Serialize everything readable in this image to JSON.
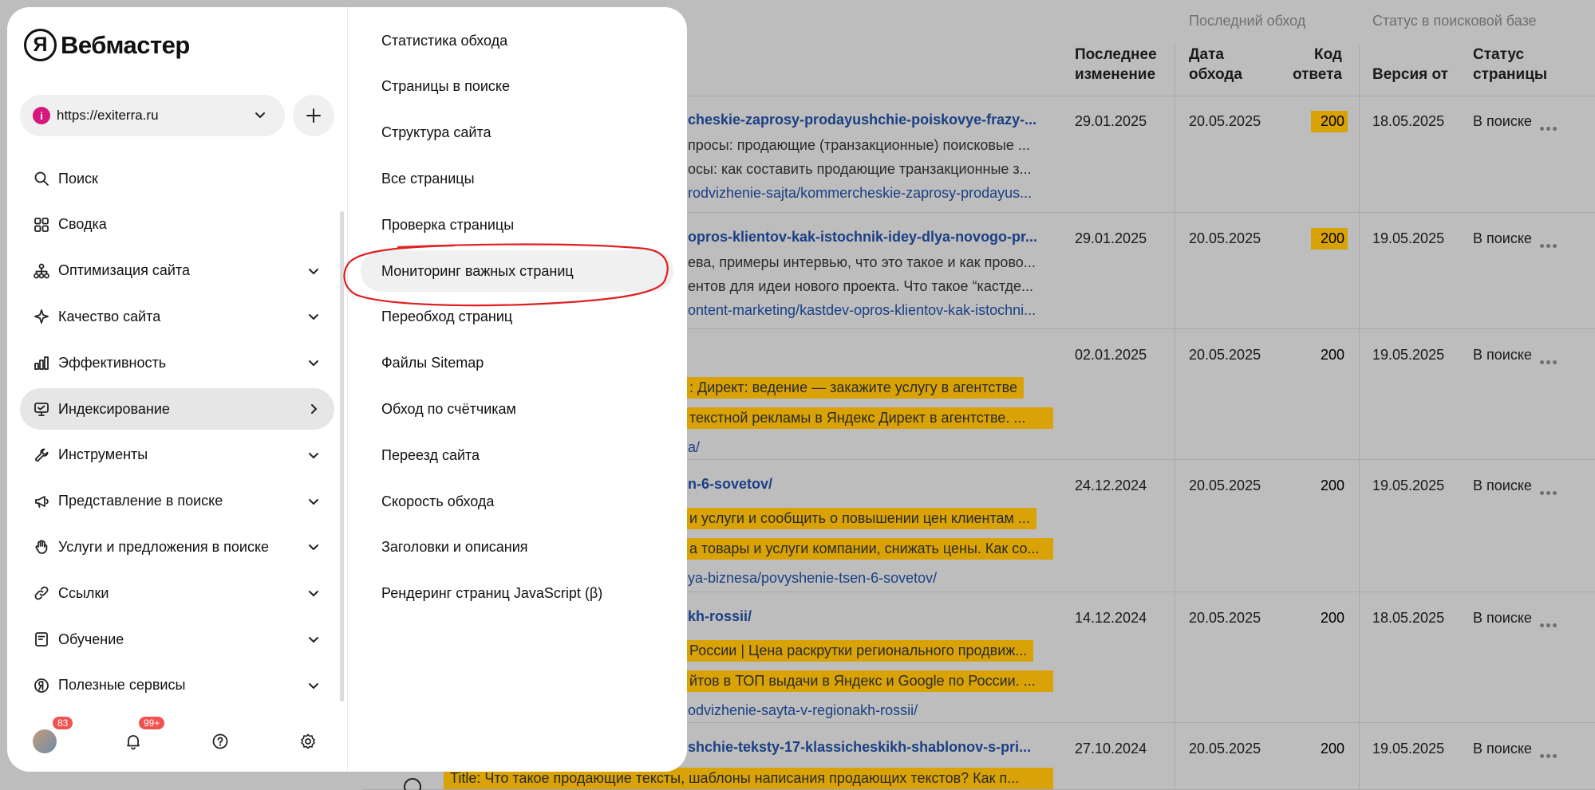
{
  "table": {
    "group_headers": {
      "last_crawl": "Последний обход",
      "search_status": "Статус в поисковой базе"
    },
    "columns": {
      "last_change": [
        "Последнее",
        "изменение"
      ],
      "crawl_date": [
        "Дата",
        "обхода"
      ],
      "response_code": [
        "Код",
        "ответа"
      ],
      "version": "Версия от",
      "page_status": [
        "Статус",
        "страницы"
      ]
    },
    "rows": [
      {
        "title": "cheskie-zaprosy-prodayushchie-poiskovye-frazy-...",
        "line1": "просы: продающие (транзакционные) поисковые ...",
        "line2": "осы: как составить продающие транзакционные з...",
        "url": "rodvizhenie-sajta/kommercheskie-zaprosy-prodayus...",
        "last_change": "29.01.2025",
        "crawl_date": "20.05.2025",
        "code": "200",
        "code_highlight": true,
        "version": "18.05.2025",
        "status": "В поиске"
      },
      {
        "title": "opros-klientov-kak-istochnik-idey-dlya-novogo-pr...",
        "line1": "ева, примеры интервью, что это такое и как прово...",
        "line2": "ентов для идеи нового проекта. Что такое “кастде...",
        "url": "ontent-marketing/kastdev-opros-klientov-kak-istochni...",
        "last_change": "29.01.2025",
        "crawl_date": "20.05.2025",
        "code": "200",
        "code_highlight": true,
        "version": "19.05.2025",
        "status": "В поиске"
      },
      {
        "title": "",
        "line1": ": Директ: ведение — закажите услугу в агентстве",
        "line2": "текстной рекламы в Яндекс Директ в агентстве. ...",
        "url": "a/",
        "last_change": "02.01.2025",
        "crawl_date": "20.05.2025",
        "code": "200",
        "code_highlight": false,
        "version": "19.05.2025",
        "status": "В поиске"
      },
      {
        "title": "n-6-sovetov/",
        "line1": "и услуги и сообщить о повышении цен клиентам ...",
        "line2": "а товары и услуги компании, снижать цены. Как со...",
        "url": "ya-biznesa/povyshenie-tsen-6-sovetov/",
        "last_change": "24.12.2024",
        "crawl_date": "20.05.2025",
        "code": "200",
        "code_highlight": false,
        "version": "19.05.2025",
        "status": "В поиске"
      },
      {
        "title": "kh-rossii/",
        "line1": "России | Цена раскрутки регионального продвиж...",
        "line2": "йтов в ТОП выдачи в Яндекс и Google по России. ...",
        "url": "odvizhenie-sayta-v-regionakh-rossii/",
        "last_change": "14.12.2024",
        "crawl_date": "20.05.2025",
        "code": "200",
        "code_highlight": false,
        "version": "18.05.2025",
        "status": "В поиске"
      },
      {
        "title": "shchie-teksty-17-klassicheskikh-shablonov-s-pri...",
        "line1": "Title: Что такое продающие тексты, шаблоны написания продающих текстов? Как п...",
        "line2": "",
        "url": "",
        "last_change": "27.10.2024",
        "crawl_date": "20.05.2025",
        "code": "200",
        "code_highlight": false,
        "version": "19.05.2025",
        "status": "В поиске"
      }
    ]
  },
  "panel": {
    "logo": {
      "badge": "Я",
      "text": "Вебмастер"
    },
    "site": {
      "favicon": "i",
      "name": "https://exiterra.ru"
    },
    "nav": [
      {
        "label": "Поиск",
        "icon": "search-icon",
        "chevron": "none"
      },
      {
        "label": "Сводка",
        "icon": "grid-icon",
        "chevron": "none"
      },
      {
        "label": "Оптимизация сайта",
        "icon": "sitemap-icon",
        "chevron": "down"
      },
      {
        "label": "Качество сайта",
        "icon": "sparkle-icon",
        "chevron": "down"
      },
      {
        "label": "Эффективность",
        "icon": "bar-chart-icon",
        "chevron": "down"
      },
      {
        "label": "Индексирование",
        "icon": "monitor-icon",
        "chevron": "right",
        "active": true
      },
      {
        "label": "Инструменты",
        "icon": "wrench-icon",
        "chevron": "down"
      },
      {
        "label": "Представление в поиске",
        "icon": "megaphone-icon",
        "chevron": "down"
      },
      {
        "label": "Услуги и предложения в поиске",
        "icon": "hand-icon",
        "chevron": "down"
      },
      {
        "label": "Ссылки",
        "icon": "link-icon",
        "chevron": "down"
      },
      {
        "label": "Обучение",
        "icon": "book-icon",
        "chevron": "down"
      },
      {
        "label": "Полезные сервисы",
        "icon": "yandex-circle-icon",
        "chevron": "down"
      }
    ],
    "footer": {
      "avatar_badge": "83",
      "notifications_badge": "99+"
    },
    "submenu": [
      "Статистика обхода",
      "Страницы в поиске",
      "Структура сайта",
      "Все страницы",
      "Проверка страницы",
      "Мониторинг важных страниц",
      "Переобход страниц",
      "Файлы Sitemap",
      "Обход по счётчикам",
      "Переезд сайта",
      "Скорость обхода",
      "Заголовки и описания",
      "Рендеринг страниц JavaScript (β)"
    ],
    "submenu_hover_index": 5,
    "annotation_color": "#e02020"
  },
  "colors": {
    "overlay": "#bdbdbd",
    "highlight": "#d9a307",
    "link": "#1b3f84",
    "badge": "#f0524f",
    "site_favicon": "#d6187e"
  }
}
